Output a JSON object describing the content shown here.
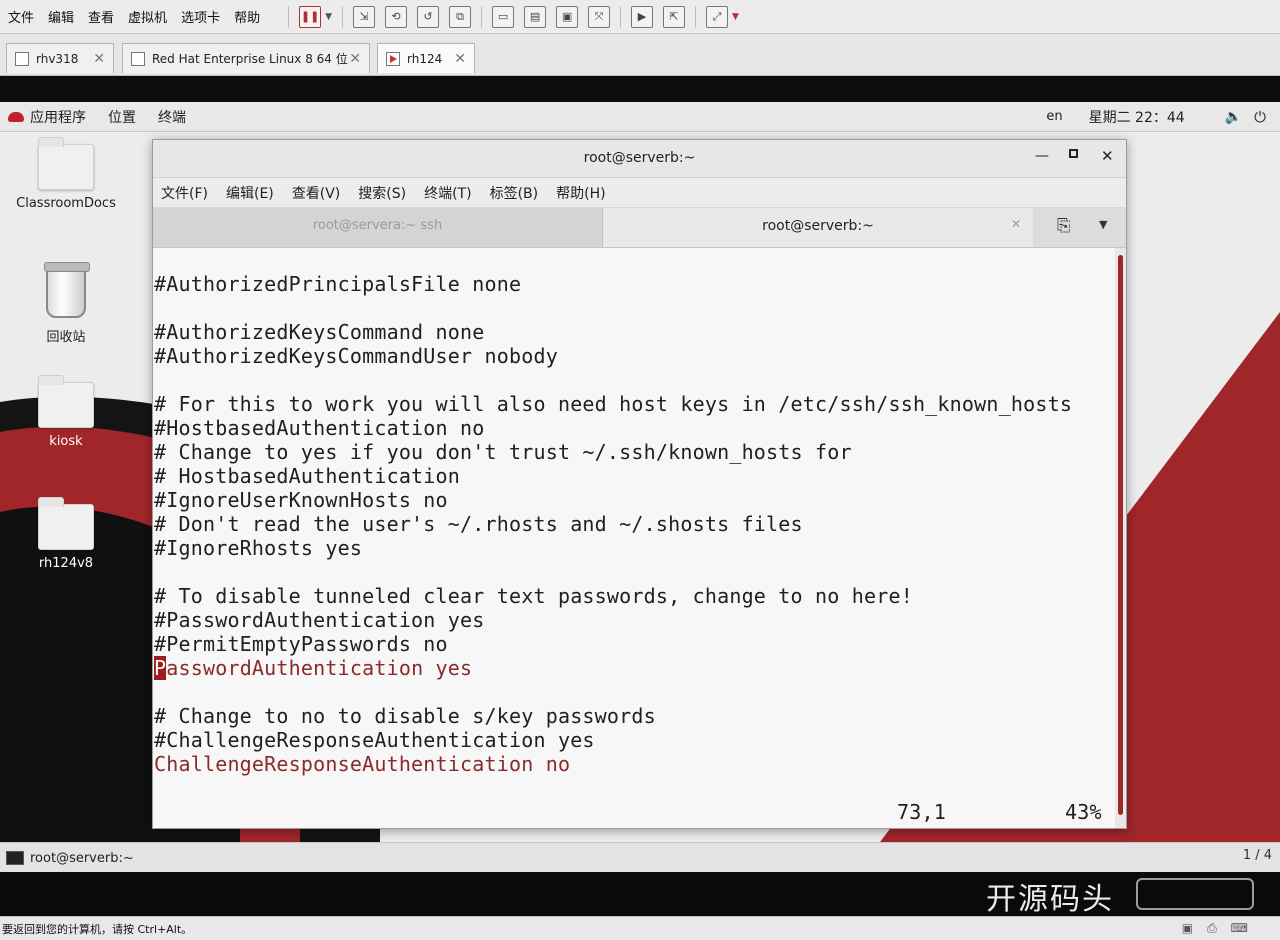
{
  "vm_menu": [
    "文件",
    "编辑",
    "查看",
    "虚拟机",
    "选项卡",
    "帮助"
  ],
  "vm_tabs": [
    {
      "label": "rhv318"
    },
    {
      "label": "Red Hat Enterprise Linux 8 64 位"
    },
    {
      "label": "rh124"
    }
  ],
  "gnome": {
    "apps": "应用程序",
    "places": "位置",
    "terminal": "终端",
    "lang": "en",
    "clock": "星期二 22：44"
  },
  "desktop_icons": [
    {
      "label": "ClassroomDocs",
      "icon": "folder-icon"
    },
    {
      "label": "回收站",
      "icon": "trash-icon"
    },
    {
      "label": "kiosk",
      "icon": "folder-icon"
    },
    {
      "label": "rh124v8",
      "icon": "folder-icon"
    }
  ],
  "terminal": {
    "title": "root@serverb:~",
    "menu": [
      "文件(F)",
      "编辑(E)",
      "查看(V)",
      "搜索(S)",
      "终端(T)",
      "标签(B)",
      "帮助(H)"
    ],
    "tabs": [
      {
        "label": "root@servera:~ ssh",
        "active": false
      },
      {
        "label": "root@serverb:~",
        "active": true
      }
    ],
    "lines": [
      "#AuthorizedPrincipalsFile none",
      "",
      "#AuthorizedKeysCommand none",
      "#AuthorizedKeysCommandUser nobody",
      "",
      "# For this to work you will also need host keys in /etc/ssh/ssh_known_hosts",
      "#HostbasedAuthentication no",
      "# Change to yes if you don't trust ~/.ssh/known_hosts for",
      "# HostbasedAuthentication",
      "#IgnoreUserKnownHosts no",
      "# Don't read the user's ~/.rhosts and ~/.shosts files",
      "#IgnoreRhosts yes",
      "",
      "# To disable tunneled clear text passwords, change to no here!",
      "#PasswordAuthentication yes",
      "#PermitEmptyPasswords no",
      "PasswordAuthentication yes",
      "",
      "# Change to no to disable s/key passwords",
      "#ChallengeResponseAuthentication yes",
      "ChallengeResponseAuthentication no"
    ],
    "cursor_line_rest": "asswordAuthentication yes",
    "cursor_char": "P",
    "status_position": "73,1",
    "status_percent": "43%"
  },
  "taskbar": {
    "window_label": "root@serverb:~",
    "workspace": "1 / 4"
  },
  "watermark": "开源码头",
  "vm_status_text": "要返回到您的计算机，请按 Ctrl+Alt。",
  "colors": {
    "accent_red": "#a0262a",
    "cursor_red": "#9b1f1f"
  }
}
